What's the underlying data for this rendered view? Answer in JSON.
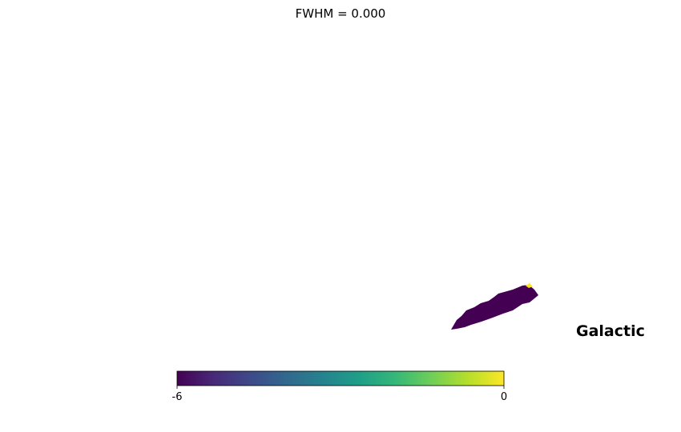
{
  "chart_data": {
    "type": "heatmap",
    "projection": "mollweide",
    "title": "FWHM = 0.000",
    "coord_label": "Galactic",
    "colormap": [
      "#440154",
      "#482878",
      "#3e4989",
      "#31688e",
      "#26828e",
      "#1f9e89",
      "#35b779",
      "#6ece58",
      "#b5de2b",
      "#fde725"
    ],
    "colorbar": {
      "min": -6,
      "max": 0,
      "tick_labels": [
        "-6",
        "0"
      ]
    },
    "region": {
      "value": -6,
      "highlight_value": 0
    }
  }
}
